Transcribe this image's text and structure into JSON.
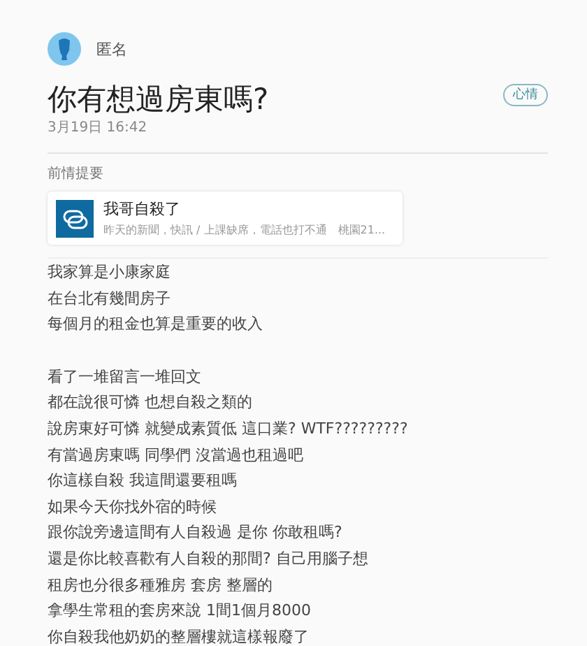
{
  "author": {
    "name": "匿名"
  },
  "post": {
    "title": "你有想過房東嗎?",
    "tag": "心情",
    "date": "3月19日 16:42"
  },
  "quote": {
    "label": "前情提要",
    "card": {
      "title": "我哥自殺了",
      "excerpt": "昨天的新聞，快訊 / 上課缺席，電話也打不通　桃園21..."
    }
  },
  "body": [
    [
      "我家算是小康家庭",
      "在台北有幾間房子",
      "每個月的租金也算是重要的收入"
    ],
    [
      "看了一堆留言一堆回文",
      "都在說很可憐 也想自殺之類的",
      "說房東好可憐 就變成素質低 這口業? WTF?????????",
      "有當過房東嗎 同學們 沒當過也租過吧",
      "你這樣自殺 我這間還要租嗎",
      "如果今天你找外宿的時候",
      "跟你說旁邊這間有人自殺過 是你 你敢租嗎?",
      "還是你比較喜歡有人自殺的那間? 自己用腦子想",
      "租房也分很多種雅房 套房 整層的",
      "拿學生常租的套房來說 1間1個月8000",
      "你自殺我他奶奶的整層樓就這樣報廢了"
    ]
  ]
}
